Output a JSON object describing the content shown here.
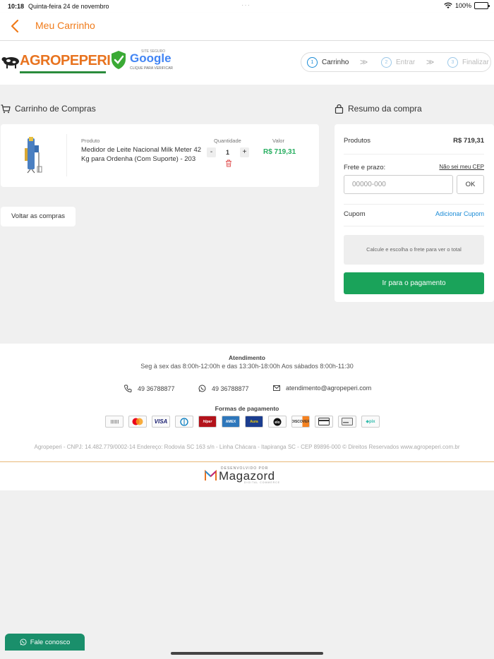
{
  "status_bar": {
    "time": "10:18",
    "date": "Quinta-feira 24 de novembro",
    "battery": "100%"
  },
  "nav": {
    "title": "Meu Carrinho"
  },
  "header": {
    "logo": {
      "part1": "AGRO",
      "part2": "PEPERI"
    },
    "seal": {
      "top": "SITE SEGURO",
      "brand": "Google",
      "bottom": "CLIQUE PARA VERIFICAR"
    },
    "steps": [
      {
        "num": "1",
        "label": "Carrinho"
      },
      {
        "num": "2",
        "label": "Entrar"
      },
      {
        "num": "3",
        "label": "Finalizar"
      }
    ]
  },
  "cart": {
    "title": "Carrinho de Compras",
    "col_product": "Produto",
    "col_qty": "Quantidade",
    "col_value": "Valor",
    "item": {
      "name": "Medidor de Leite Nacional Milk Meter 42 Kg para Ordenha (Com Suporte) - 203",
      "qty_minus": "-",
      "qty": "1",
      "qty_plus": "+",
      "price": "R$ 719,31"
    },
    "back_button": "Voltar as compras"
  },
  "summary": {
    "title": "Resumo da compra",
    "products_label": "Produtos",
    "products_value": "R$ 719,31",
    "shipping_label": "Frete e prazo:",
    "shipping_link": "Não sei meu CEP",
    "cep_placeholder": "00000-000",
    "ok_label": "OK",
    "coupon_label": "Cupom",
    "coupon_link": "Adicionar Cupom",
    "calc_note": "Calcule e escolha o frete para ver o total",
    "pay_button": "Ir para o pagamento"
  },
  "footer": {
    "support_title": "Atendimento",
    "support_hours": "Seg à sex das 8:00h-12:00h e das 13:30h-18:00h Aos sábados 8:00h-11:30",
    "phone": "49 36788877",
    "whatsapp": "49 36788877",
    "email": "atendimento@agropeperi.com",
    "payment_title": "Formas de pagamento",
    "payment_methods": [
      "BOLETO",
      "MasterCard",
      "VISA",
      "Diners",
      "Hipercard",
      "AMEX",
      "Aura",
      "elo",
      "DISCOVER",
      "card",
      "debit",
      "pix"
    ],
    "legal": "Agropeperi - CNPJ: 14.482.779/0002-14 Endereço: Rodovia SC 163 s/n - Linha Chácara - Itapiranga SC - CEP 89896-000 © Direitos Reservados www.agropeperi.com.br",
    "dev_by": "DESENVOLVIDO POR",
    "dev_name": "Magazord",
    "dev_sub": "DIGITAL COMMERCE"
  },
  "chat_button": "Fale conosco",
  "colors": {
    "accent": "#f07b1a",
    "green": "#1aa35a",
    "price": "#27ae60",
    "link": "#1a8bd6"
  }
}
